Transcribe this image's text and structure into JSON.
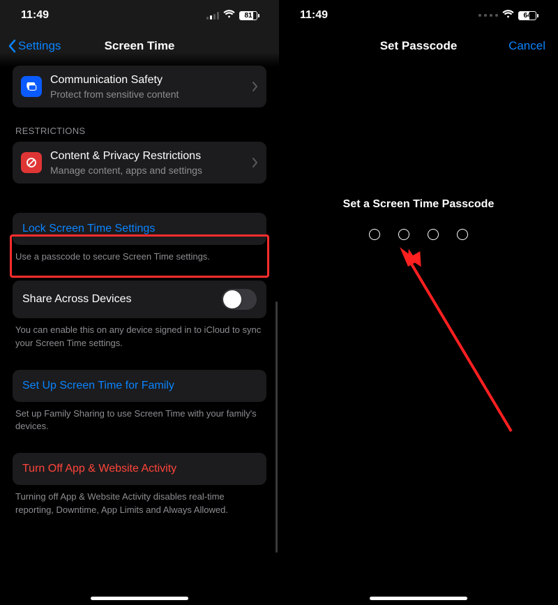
{
  "left": {
    "status_time": "11:49",
    "battery": "81",
    "nav_back": "Settings",
    "nav_title": "Screen Time",
    "comm_safety": {
      "title": "Communication Safety",
      "sub": "Protect from sensitive content"
    },
    "restrictions_header": "Restrictions",
    "content_privacy": {
      "title": "Content & Privacy Restrictions",
      "sub": "Manage content, apps and settings"
    },
    "lock": "Lock Screen Time Settings",
    "lock_footer": "Use a passcode to secure Screen Time settings.",
    "share": "Share Across Devices",
    "share_footer": "You can enable this on any device signed in to iCloud to sync your Screen Time settings.",
    "family": "Set Up Screen Time for Family",
    "family_footer": "Set up Family Sharing to use Screen Time with your family's devices.",
    "turnoff": "Turn Off App & Website Activity",
    "turnoff_footer": "Turning off App & Website Activity disables real-time reporting, Downtime, App Limits and Always Allowed."
  },
  "right": {
    "status_time": "11:49",
    "battery": "64",
    "nav_title": "Set Passcode",
    "nav_cancel": "Cancel",
    "prompt": "Set a Screen Time Passcode"
  }
}
